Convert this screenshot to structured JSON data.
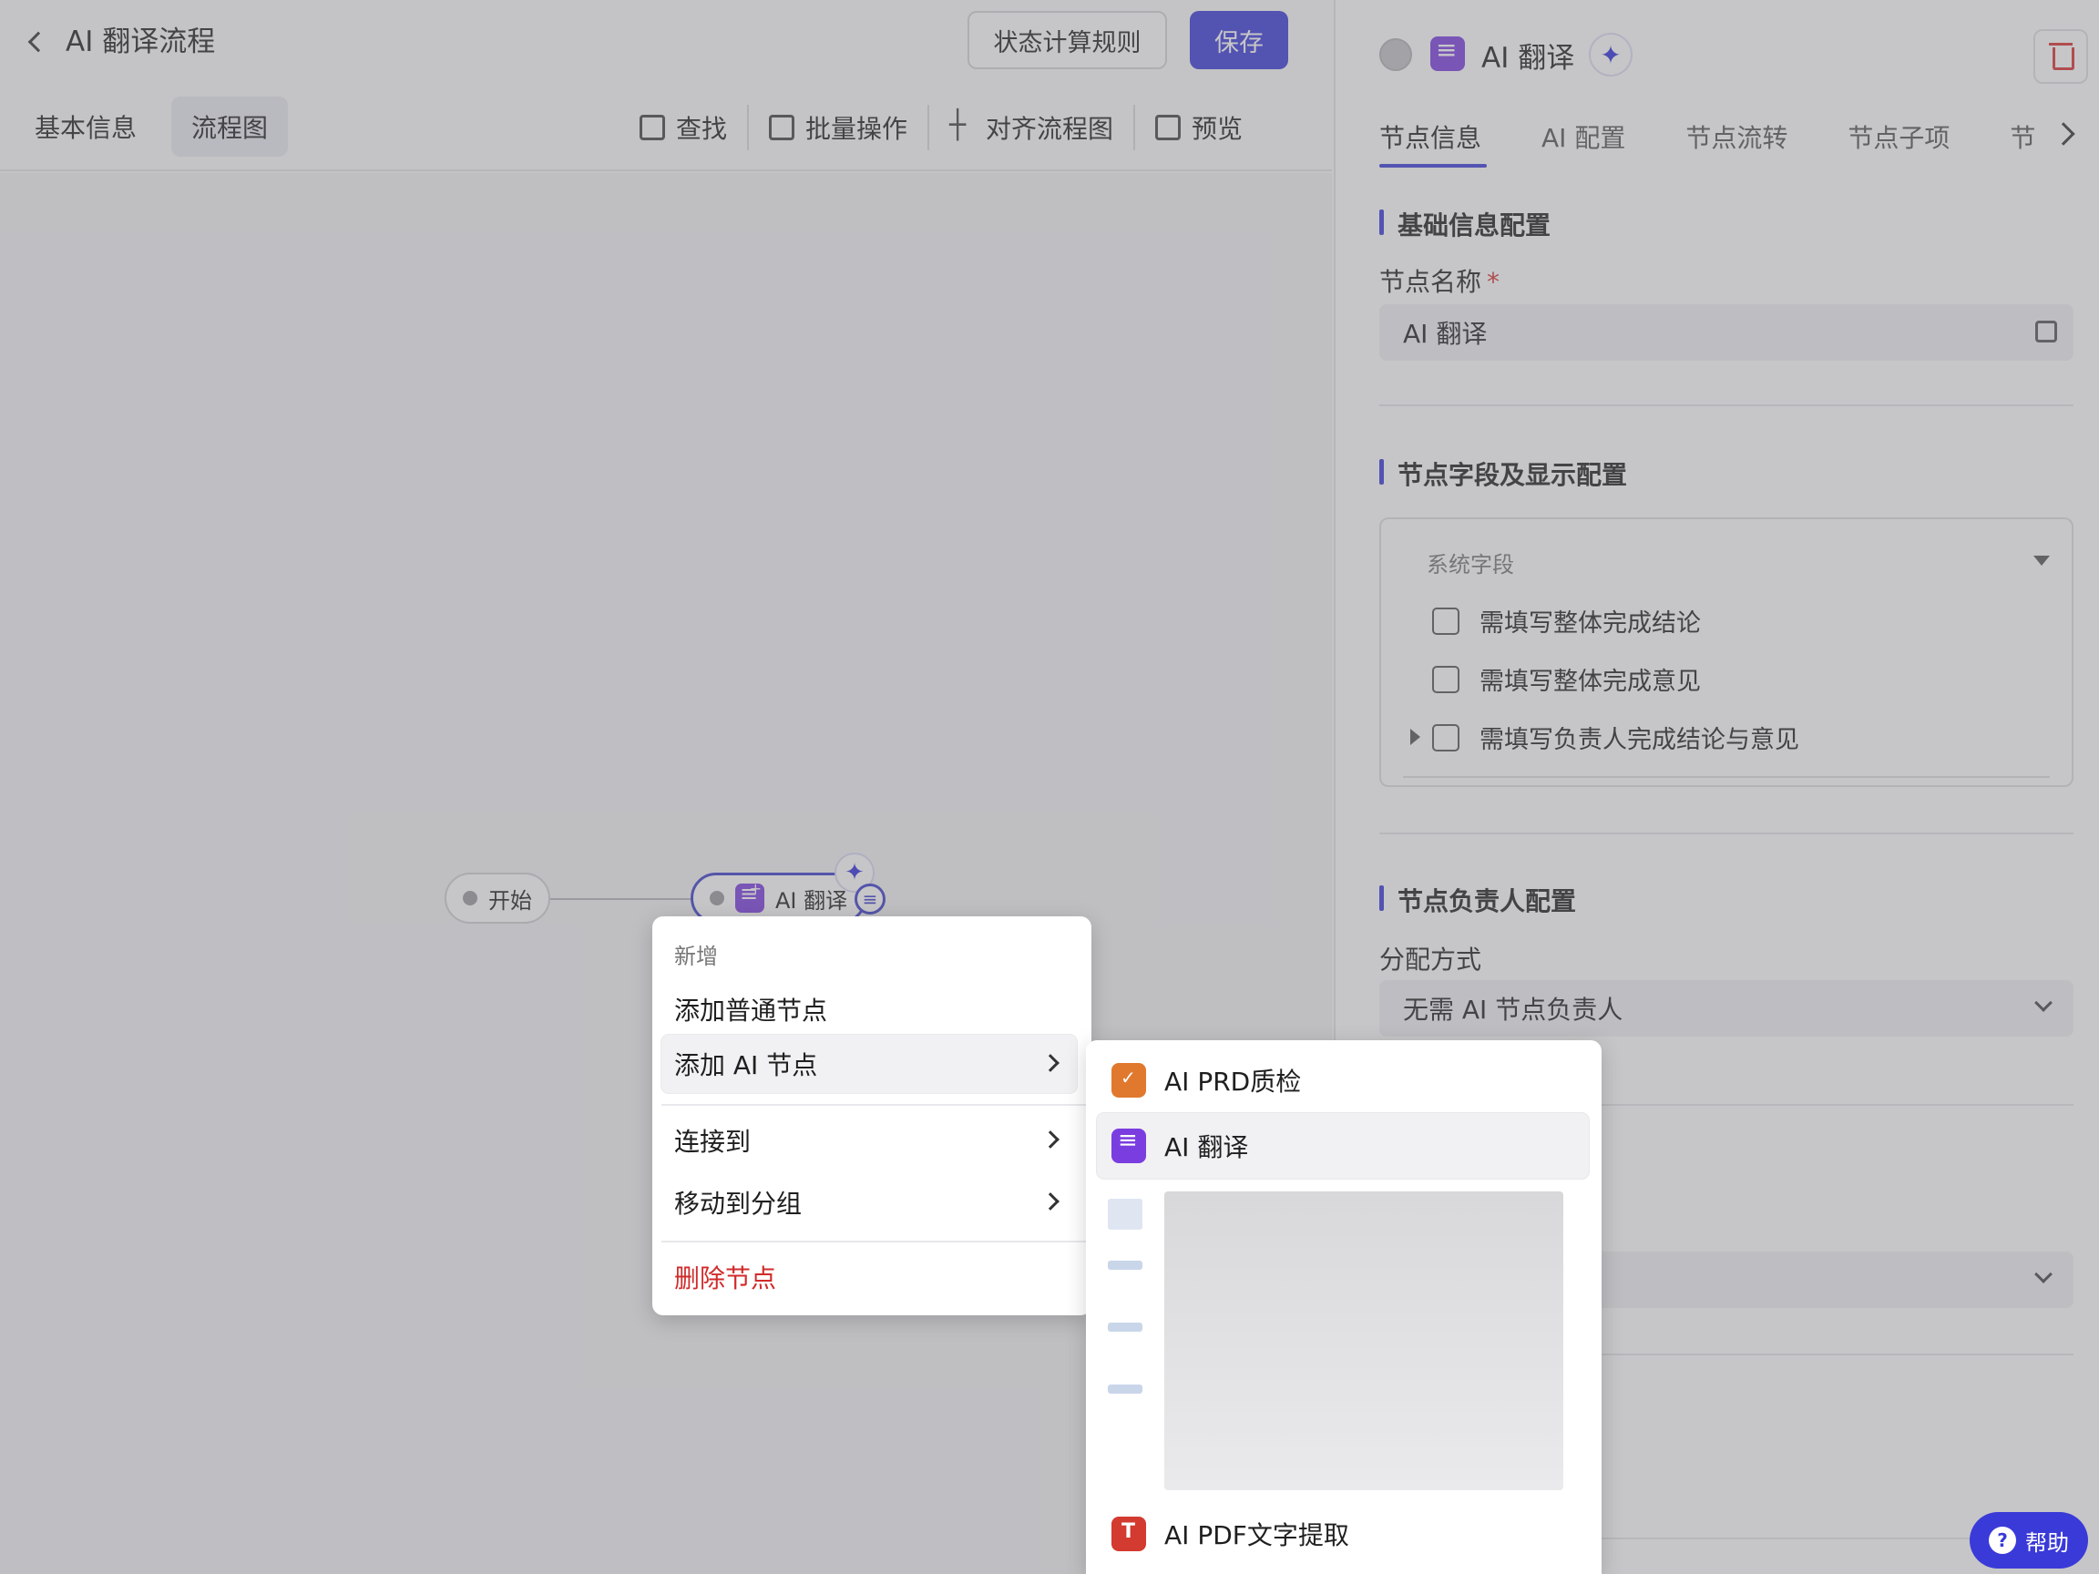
{
  "header": {
    "title": "AI 翻译流程",
    "rules_button": "状态计算规则",
    "save_button": "保存"
  },
  "left_tabs": [
    {
      "label": "基本信息"
    },
    {
      "label": "流程图",
      "active": true
    }
  ],
  "toolbar": {
    "find": "查找",
    "batch": "批量操作",
    "align": "对齐流程图",
    "preview": "预览"
  },
  "canvas": {
    "start_node": "开始",
    "ai_node": "AI 翻译"
  },
  "context_menu": {
    "header": "新增",
    "add_normal": "添加普通节点",
    "add_ai": "添加 AI 节点",
    "connect_to": "连接到",
    "move_to_group": "移动到分组",
    "delete_node": "删除节点"
  },
  "submenu": {
    "items": [
      {
        "label": "AI PRD质检",
        "icon": "shield-check-icon"
      },
      {
        "label": "AI 翻译",
        "icon": "ai-translate-icon",
        "selected": true
      },
      {
        "label": "AI PDF文字提取",
        "icon": "pdf-icon"
      }
    ]
  },
  "panel": {
    "node_title": "AI 翻译",
    "tabs": [
      "节点信息",
      "AI 配置",
      "节点流转",
      "节点子项",
      "节"
    ],
    "section_basic": "基础信息配置",
    "node_name_label": "节点名称",
    "required_mark": "*",
    "node_name_value": "AI 翻译",
    "section_fields": "节点字段及显示配置",
    "system_fields": "系统字段",
    "checkboxes": [
      "需填写整体完成结论",
      "需填写整体完成意见",
      "需填写负责人完成结论与意见"
    ],
    "section_owner": "节点负责人配置",
    "assign_label": "分配方式",
    "assign_value": "无需 AI 节点负责人"
  },
  "help": "帮助",
  "colors": {
    "accent": "#3a3ad9",
    "ai_icon": "#7a3de0",
    "danger": "#d12b2b"
  }
}
